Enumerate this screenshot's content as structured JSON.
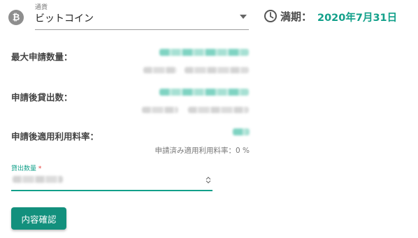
{
  "currency": {
    "field_label": "通貨",
    "icon_glyph": "₿",
    "icon": "bitcoin-icon",
    "selected": "ビットコイン"
  },
  "maturity": {
    "icon": "clock-icon",
    "label": "満期：",
    "date": "2020年7月31日"
  },
  "rows": {
    "max_apply_qty": {
      "label": "最大申請数量："
    },
    "after_apply_lending": {
      "label": "申請後貸出数："
    },
    "after_apply_rate": {
      "label": "申請後適用利用料率："
    }
  },
  "applied_rate_note": "申請済み適用利用料率：0 %",
  "amount_input": {
    "label": "貸出数量",
    "required_mark": "*"
  },
  "confirm_button": {
    "label": "内容確認"
  },
  "colors": {
    "accent": "#12a08a",
    "button": "#13907d",
    "required": "#e53935"
  }
}
